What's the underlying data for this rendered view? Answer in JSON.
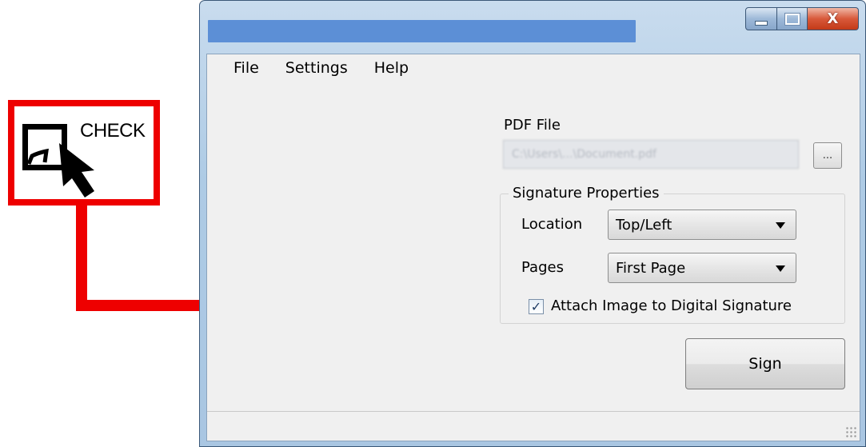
{
  "annotation": {
    "label": "CHECK",
    "color": "#ee0000"
  },
  "window": {
    "title_color": "#5c8fd6",
    "close_glyph": "X"
  },
  "menu": [
    "File",
    "Settings",
    "Help"
  ],
  "form": {
    "pdf_label": "PDF File",
    "pdf_value": "C:\\Users\\...\\Document.pdf",
    "browse_label": "...",
    "group_title": "Signature Properties",
    "location_label": "Location",
    "location_value": "Top/Left",
    "pages_label": "Pages",
    "pages_value": "First Page",
    "attach_label": "Attach Image to Digital Signature",
    "attach_checked": true,
    "sign_label": "Sign"
  }
}
